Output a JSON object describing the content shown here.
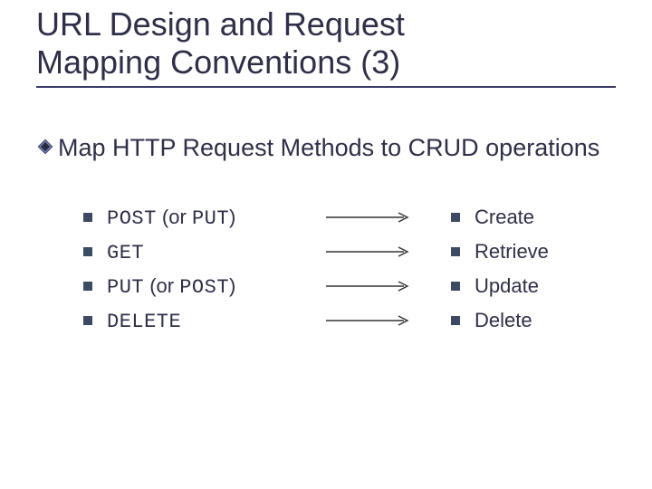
{
  "title_line1": "URL Design and Request",
  "title_line2": "Mapping Conventions (3)",
  "main_bullet": "Map HTTP Request Methods to CRUD operations",
  "rows": [
    {
      "left_mono1": "POST",
      "left_plain": " (or ",
      "left_mono2": "PUT",
      "left_plain2": ")",
      "right": "Create"
    },
    {
      "left_mono1": "GET",
      "left_plain": "",
      "left_mono2": "",
      "left_plain2": "",
      "right": "Retrieve"
    },
    {
      "left_mono1": "PUT",
      "left_plain": " (or ",
      "left_mono2": "POST",
      "left_plain2": ")",
      "right": "Update"
    },
    {
      "left_mono1": "DELETE",
      "left_plain": "",
      "left_mono2": "",
      "left_plain2": "",
      "right": "Delete"
    }
  ]
}
